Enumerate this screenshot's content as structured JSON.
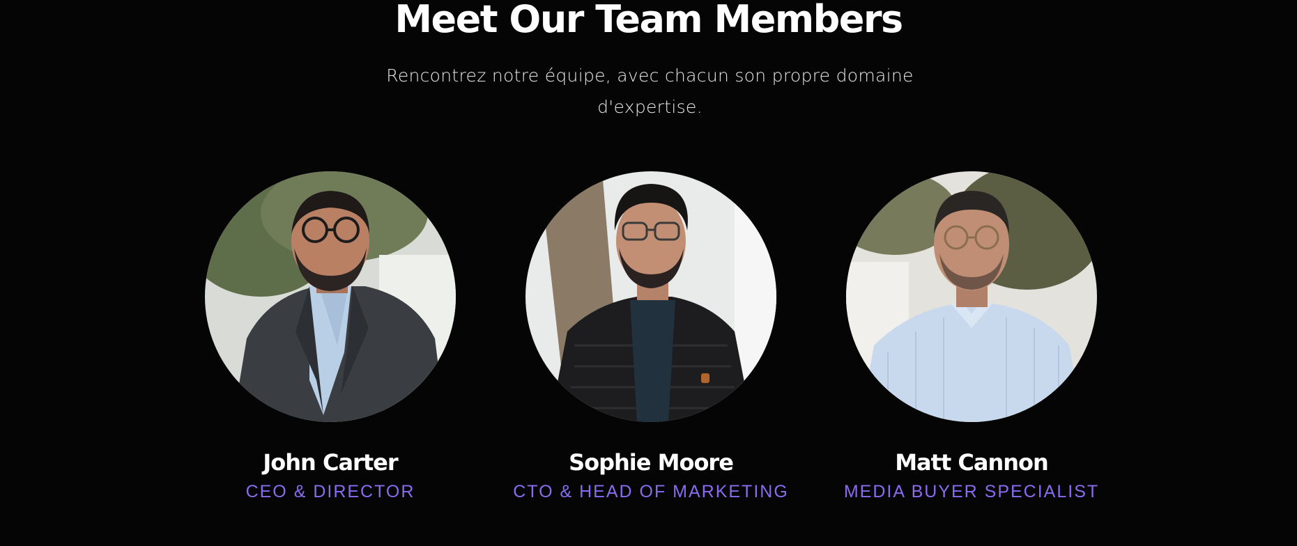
{
  "section": {
    "title": "Meet Our Team Members",
    "subtitle": "Rencontrez notre équipe, avec chacun son propre domaine d'expertise."
  },
  "colors": {
    "background": "#050505",
    "accent": "#8a6cf0",
    "text": "#ffffff"
  },
  "team": [
    {
      "name": "John Carter",
      "role": "CEO & DIRECTOR",
      "photo_icon": "portrait-photo"
    },
    {
      "name": "Sophie Moore",
      "role": "CTO & HEAD OF MARKETING",
      "photo_icon": "portrait-photo"
    },
    {
      "name": "Matt Cannon",
      "role": "MEDIA BUYER SPECIALIST",
      "photo_icon": "portrait-photo"
    }
  ]
}
